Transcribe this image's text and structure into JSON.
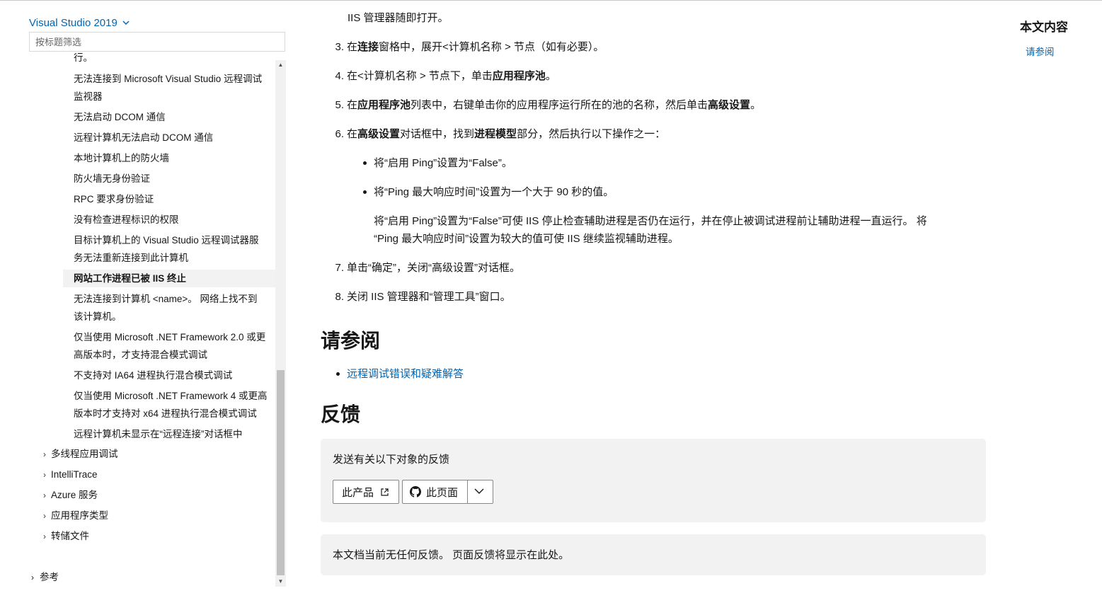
{
  "sidebar": {
    "version": "Visual Studio 2019",
    "filter_placeholder": "按标题筛选",
    "cut_item": "行。",
    "sub_items": [
      {
        "label_lines": [
          "无法连接到 Microsoft Visual Studio 远程调试",
          "监视器"
        ]
      },
      {
        "label_lines": [
          "无法启动 DCOM 通信"
        ]
      },
      {
        "label_lines": [
          "远程计算机无法启动 DCOM 通信"
        ]
      },
      {
        "label_lines": [
          "本地计算机上的防火墙"
        ]
      },
      {
        "label_lines": [
          "防火墙无身份验证"
        ]
      },
      {
        "label_lines": [
          "RPC 要求身份验证"
        ]
      },
      {
        "label_lines": [
          "没有检查进程标识的权限"
        ]
      },
      {
        "label_lines": [
          "目标计算机上的 Visual Studio 远程调试器服",
          "务无法重新连接到此计算机"
        ]
      },
      {
        "label_lines": [
          "网站工作进程已被 IIS 终止"
        ],
        "active": true
      },
      {
        "label_lines": [
          "无法连接到计算机 <name>。 网络上找不到",
          "该计算机。"
        ]
      },
      {
        "label_lines": [
          "仅当使用 Microsoft .NET Framework 2.0 或更",
          "高版本时，才支持混合模式调试"
        ]
      },
      {
        "label_lines": [
          "不支持对 IA64 进程执行混合模式调试"
        ]
      },
      {
        "label_lines": [
          "仅当使用 Microsoft .NET Framework 4 或更高",
          "版本时才支持对 x64 进程执行混合模式调试"
        ]
      },
      {
        "label_lines": [
          "远程计算机未显示在“远程连接”对话框中"
        ]
      }
    ],
    "top_items": [
      "多线程应用调试",
      "IntelliTrace",
      "Azure 服务",
      "应用程序类型",
      "转储文件"
    ],
    "reference": "参考",
    "arrow": "›"
  },
  "article": {
    "intro_line": "IIS 管理器随即打开。",
    "steps": [
      {
        "n": "3.",
        "parts": [
          [
            "在",
            false
          ],
          [
            "连接",
            true
          ],
          [
            "窗格中，展开<计算机名称 > 节点（如有必要）。",
            false
          ]
        ]
      },
      {
        "n": "4.",
        "parts": [
          [
            "在<计算机名称 > 节点下，单击",
            false
          ],
          [
            "应用程序池",
            true
          ],
          [
            "。",
            false
          ]
        ]
      },
      {
        "n": "5.",
        "parts": [
          [
            "在",
            false
          ],
          [
            "应用程序池",
            true
          ],
          [
            "列表中，右键单击你的应用程序运行所在的池的名称，然后单击",
            false
          ],
          [
            "高级设置",
            true
          ],
          [
            "。",
            false
          ]
        ]
      },
      {
        "n": "6.",
        "parts": [
          [
            "在",
            false
          ],
          [
            "高级设置",
            true
          ],
          [
            "对话框中，找到",
            false
          ],
          [
            "进程模型",
            true
          ],
          [
            "部分，然后执行以下操作之一：",
            false
          ]
        ]
      }
    ],
    "bullets": [
      "将“启用 Ping”设置为“False”。",
      "将“Ping 最大响应时间”设置为一个大于 90 秒的值。"
    ],
    "note_lines": [
      "将“启用 Ping”设置为“False”可使 IIS 停止检查辅助进程是否仍在运行，并在停止被调试进程前让辅助进程一直运行。 将",
      "“Ping 最大响应时间”设置为较大的值可使 IIS 继续监视辅助进程。"
    ],
    "step7": {
      "n": "7.",
      "text": "单击“确定”，关闭“高级设置”对话框。"
    },
    "step8": {
      "n": "8.",
      "text": "关闭 IIS 管理器和“管理工具”窗口。"
    },
    "see_also_heading": "请参阅",
    "see_also_link": "远程调试错误和疑难解答",
    "feedback_heading": "反馈",
    "feedback_prompt": "发送有关以下对象的反馈",
    "btn_product": "此产品",
    "btn_page": "此页面",
    "no_feedback": "本文档当前无任何反馈。 页面反馈将显示在此处。"
  },
  "right_toc": {
    "title": "本文内容",
    "link": "请参阅"
  }
}
